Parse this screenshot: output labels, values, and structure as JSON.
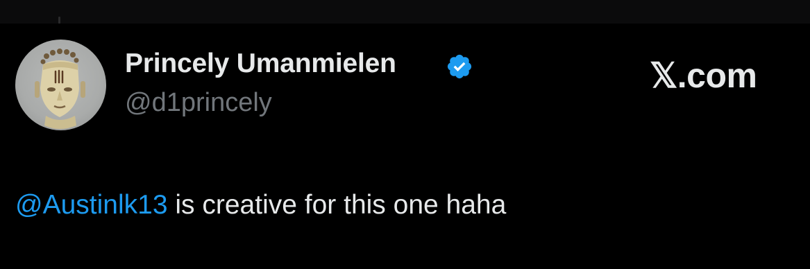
{
  "author": {
    "display_name": "Princely Umanmielen",
    "handle": "@d1princely",
    "verified": true
  },
  "brand": {
    "label": "𝕏.com"
  },
  "tweet": {
    "mention": "@Austinlk13",
    "text": " is creative for this one haha"
  },
  "colors": {
    "background": "#000000",
    "text_primary": "#e7e9ea",
    "text_secondary": "#71767b",
    "link": "#1d9bf0",
    "verified_badge": "#1d9bf0"
  },
  "icons": {
    "verified": "verified-badge-icon",
    "avatar": "avatar-image"
  }
}
